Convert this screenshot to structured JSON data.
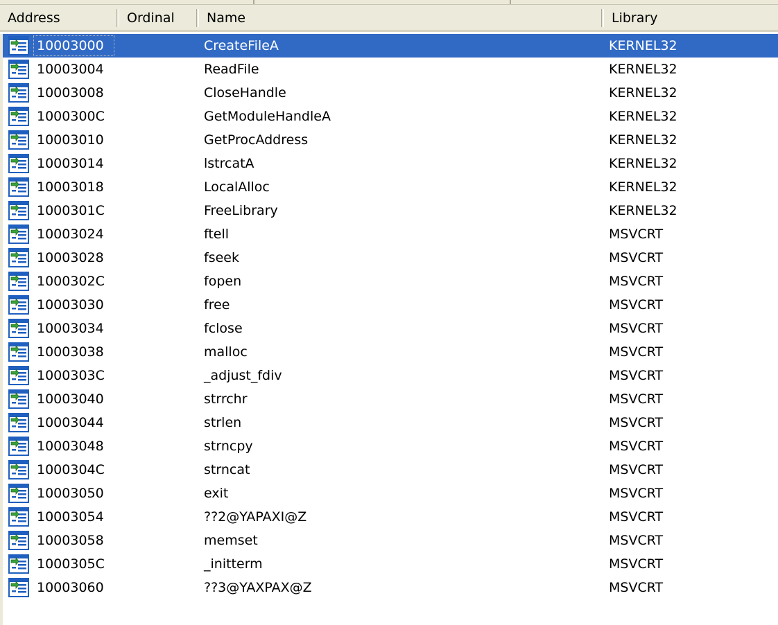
{
  "columns": {
    "address": "Address",
    "ordinal": "Ordinal",
    "name": "Name",
    "library": "Library"
  },
  "rows": [
    {
      "address": "10003000",
      "ordinal": "",
      "name": "CreateFileA",
      "library": "KERNEL32",
      "selected": true
    },
    {
      "address": "10003004",
      "ordinal": "",
      "name": "ReadFile",
      "library": "KERNEL32"
    },
    {
      "address": "10003008",
      "ordinal": "",
      "name": "CloseHandle",
      "library": "KERNEL32"
    },
    {
      "address": "1000300C",
      "ordinal": "",
      "name": "GetModuleHandleA",
      "library": "KERNEL32"
    },
    {
      "address": "10003010",
      "ordinal": "",
      "name": "GetProcAddress",
      "library": "KERNEL32"
    },
    {
      "address": "10003014",
      "ordinal": "",
      "name": "lstrcatA",
      "library": "KERNEL32"
    },
    {
      "address": "10003018",
      "ordinal": "",
      "name": "LocalAlloc",
      "library": "KERNEL32"
    },
    {
      "address": "1000301C",
      "ordinal": "",
      "name": "FreeLibrary",
      "library": "KERNEL32"
    },
    {
      "address": "10003024",
      "ordinal": "",
      "name": "ftell",
      "library": "MSVCRT"
    },
    {
      "address": "10003028",
      "ordinal": "",
      "name": "fseek",
      "library": "MSVCRT"
    },
    {
      "address": "1000302C",
      "ordinal": "",
      "name": "fopen",
      "library": "MSVCRT"
    },
    {
      "address": "10003030",
      "ordinal": "",
      "name": "free",
      "library": "MSVCRT"
    },
    {
      "address": "10003034",
      "ordinal": "",
      "name": "fclose",
      "library": "MSVCRT"
    },
    {
      "address": "10003038",
      "ordinal": "",
      "name": "malloc",
      "library": "MSVCRT"
    },
    {
      "address": "1000303C",
      "ordinal": "",
      "name": "_adjust_fdiv",
      "library": "MSVCRT"
    },
    {
      "address": "10003040",
      "ordinal": "",
      "name": "strrchr",
      "library": "MSVCRT"
    },
    {
      "address": "10003044",
      "ordinal": "",
      "name": "strlen",
      "library": "MSVCRT"
    },
    {
      "address": "10003048",
      "ordinal": "",
      "name": "strncpy",
      "library": "MSVCRT"
    },
    {
      "address": "1000304C",
      "ordinal": "",
      "name": "strncat",
      "library": "MSVCRT"
    },
    {
      "address": "10003050",
      "ordinal": "",
      "name": "exit",
      "library": "MSVCRT"
    },
    {
      "address": "10003054",
      "ordinal": "",
      "name": "??2@YAPAXI@Z",
      "library": "MSVCRT"
    },
    {
      "address": "10003058",
      "ordinal": "",
      "name": "memset",
      "library": "MSVCRT"
    },
    {
      "address": "1000305C",
      "ordinal": "",
      "name": "_initterm",
      "library": "MSVCRT"
    },
    {
      "address": "10003060",
      "ordinal": "",
      "name": "??3@YAXPAX@Z",
      "library": "MSVCRT"
    }
  ],
  "row_icon": "import-function-icon",
  "colors": {
    "selection": "#316ac5",
    "header_bg": "#ebeadb",
    "icon_blue": "#1f5fbf",
    "icon_green": "#3aa23a"
  }
}
